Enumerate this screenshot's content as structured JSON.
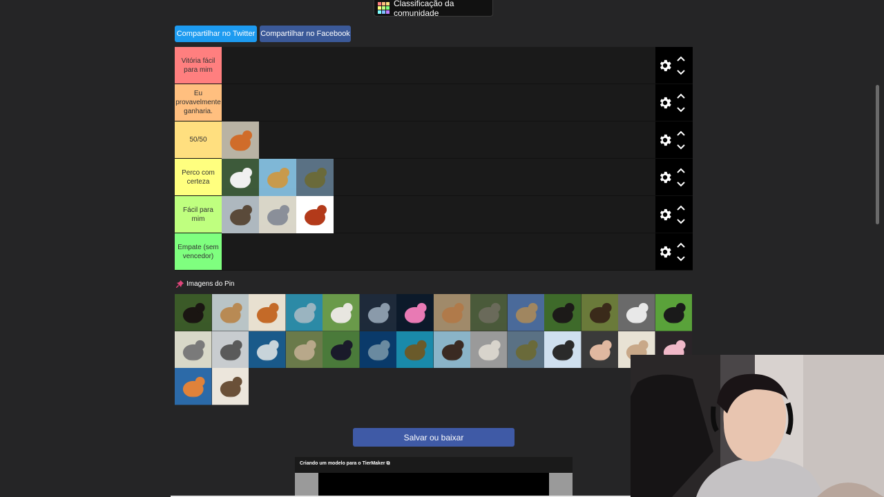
{
  "community": {
    "label": "Classificação da comunidade",
    "icon": "grid-icon"
  },
  "share": {
    "twitter": "Compartilhar no Twitter",
    "facebook": "Compartilhar no Facebook"
  },
  "tiers": [
    {
      "label": "Vitória fácil para mim",
      "color": "#ff7f7f"
    },
    {
      "label": "Eu provavelmente ganharia.",
      "color": "#ffbf7f"
    },
    {
      "label": "50/50",
      "color": "#ffdf7f"
    },
    {
      "label": "Perco com certeza",
      "color": "#ffff7f"
    },
    {
      "label": "Fácil para mim",
      "color": "#bfff7f"
    },
    {
      "label": "Empate (sem vencedor)",
      "color": "#7fff7f"
    }
  ],
  "tier_items": {
    "t2": [
      "fox"
    ],
    "t3": [
      "panda",
      "giraffe",
      "crocodile"
    ],
    "t4": [
      "goose",
      "pigeon",
      "ant"
    ]
  },
  "pin": {
    "title": "Imagens do Pin",
    "icon": "pin-icon"
  },
  "pool": [
    "bear",
    "camel",
    "dog",
    "dolphin",
    "goat",
    "snake",
    "jellyfish",
    "kangaroo",
    "turtle",
    "meerkat",
    "chimpanzee",
    "moose",
    "raccoon",
    "toucan",
    "rhino",
    "seal",
    "shark",
    "sloth",
    "ostrich",
    "fish",
    "sea-turtle",
    "walrus",
    "wolf",
    "crocodile",
    "cow",
    "man",
    "sea-lion",
    "axolotl",
    "octopus",
    "porcupine"
  ],
  "save_label": "Salvar ou baixar",
  "ad": {
    "title": "Criando um modelo para o TierMaker"
  },
  "colors": {
    "twitter": "#1d9bf0",
    "facebook": "#3b5998",
    "save": "#3f5aa6"
  }
}
